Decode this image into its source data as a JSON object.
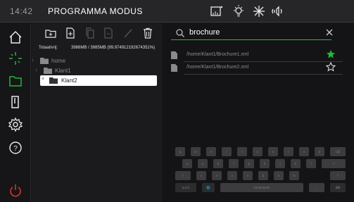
{
  "header": {
    "time": "14:42",
    "title": "PROGRAMMA MODUS",
    "icons": [
      "oven-icon",
      "light-icon",
      "fan-icon",
      "volume-icon"
    ]
  },
  "sidebar": {
    "items": [
      {
        "icon": "home-icon"
      },
      {
        "icon": "crosshair-icon"
      },
      {
        "icon": "folder-icon",
        "active": true
      },
      {
        "icon": "door-icon"
      },
      {
        "icon": "gear-icon"
      },
      {
        "icon": "help-icon"
      },
      {
        "icon": "power-icon"
      }
    ]
  },
  "colors": {
    "accent_green": "#24b63a",
    "power_red": "#e0302a"
  },
  "filepane": {
    "toolbar": [
      "new-folder-icon",
      "new-file-icon",
      "copy-icon",
      "paste-icon",
      "edit-icon",
      "delete-icon"
    ],
    "stats_label": "Totaal/vrij:",
    "stats_value": "3986MB / 3985MB (99.974912192674351%)",
    "tree": [
      {
        "name": "home",
        "arrow": "↓"
      },
      {
        "name": "Klant1",
        "arrow": "↓"
      },
      {
        "name": "Klant2",
        "arrow": "×",
        "selected": true
      }
    ]
  },
  "search": {
    "value": "brochure",
    "results": [
      {
        "path": "/home/Klant1/Brochure1.xml",
        "favorite": true
      },
      {
        "path": "/home/Klant1/Brochure2.xml",
        "favorite": false
      }
    ]
  },
  "keyboard": {
    "row1": [
      "q",
      "w",
      "e",
      "r",
      "t",
      "y",
      "u",
      "i",
      "o",
      "p",
      "⌫"
    ],
    "row2": [
      "a",
      "s",
      "d",
      "f",
      "g",
      "h",
      "j",
      "k",
      "l",
      "⏎"
    ],
    "row3": [
      "⇧",
      "z",
      "x",
      "c",
      "v",
      "b",
      "n",
      "m",
      "⇧"
    ],
    "row4": [
      "&123",
      "🌐",
      "Nederlands",
      "_",
      "⌨"
    ]
  }
}
